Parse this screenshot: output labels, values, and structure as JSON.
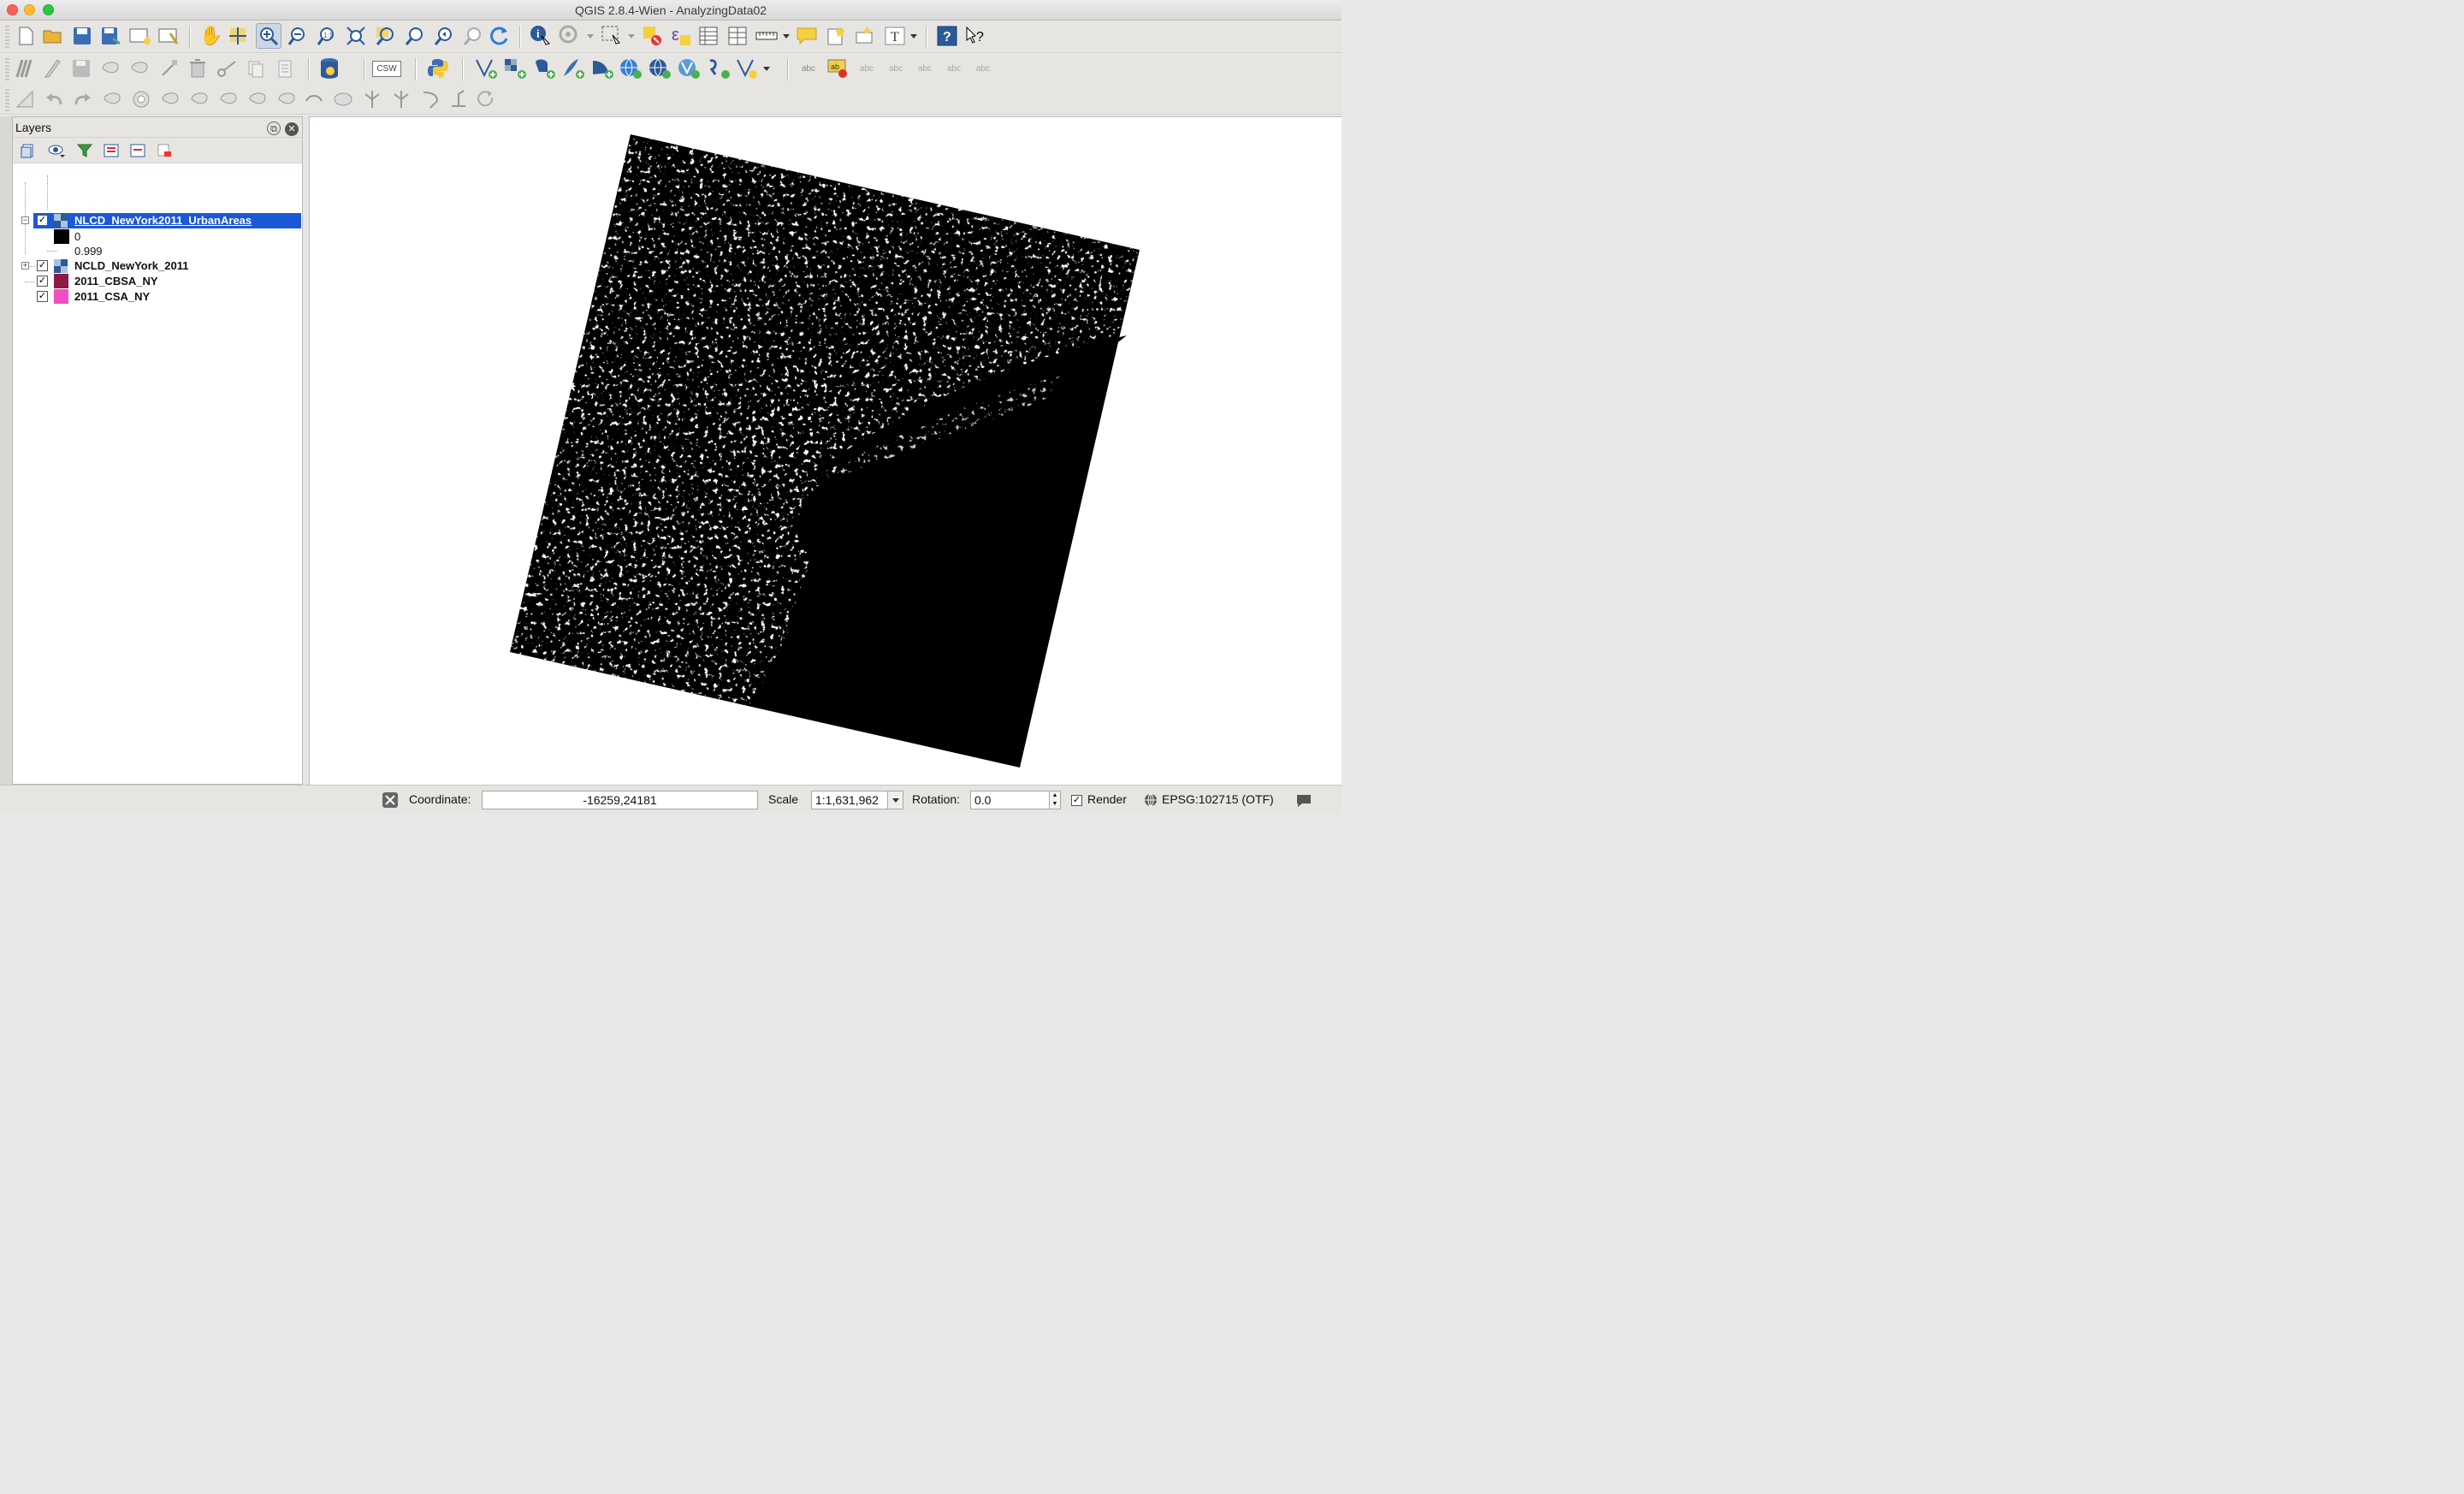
{
  "window": {
    "title": "QGIS 2.8.4-Wien - AnalyzingData02"
  },
  "toolbar1": {
    "icons": [
      "new-project-icon",
      "open-project-icon",
      "save-project-icon",
      "save-as-icon",
      "new-print-composer-icon",
      "composer-manager-icon",
      "pan-icon",
      "pan-to-selection-icon",
      "zoom-in-icon",
      "zoom-out-icon",
      "zoom-actual-size-icon",
      "zoom-full-icon",
      "zoom-to-selection-icon",
      "zoom-to-layer-icon",
      "zoom-last-icon",
      "zoom-next-icon",
      "refresh-icon",
      "identify-icon",
      "run-action-icon",
      "select-features-icon",
      "deselect-icon",
      "select-by-expression-icon",
      "attribute-table-icon",
      "field-calculator-icon",
      "measure-icon",
      "map-tips-icon",
      "new-bookmark-icon",
      "show-bookmarks-icon",
      "text-annotation-icon",
      "help-icon",
      "whats-this-icon"
    ]
  },
  "toolbar2": {
    "csw_label": "CSW",
    "label_tools_text": "abc"
  },
  "layers_panel": {
    "title": "Layers",
    "layers": [
      {
        "name": "NLCD_NewYork2011_UrbanAreas",
        "checked": true,
        "expanded": true,
        "selected": true,
        "legend": [
          {
            "label": "0",
            "color": "#000000"
          },
          {
            "label": "0.999",
            "color": "#ffffff"
          }
        ]
      },
      {
        "name": "NCLD_NewYork_2011",
        "checked": true,
        "expanded": false
      },
      {
        "name": "2011_CBSA_NY",
        "checked": true,
        "color": "#8b1a46"
      },
      {
        "name": "2011_CSA_NY",
        "checked": true,
        "color": "#f04fc4"
      }
    ]
  },
  "statusbar": {
    "coordinate_label": "Coordinate:",
    "coordinate_value": "-16259,24181",
    "scale_label": "Scale",
    "scale_value": "1:1,631,962",
    "rotation_label": "Rotation:",
    "rotation_value": "0.0",
    "render_label": "Render",
    "render_checked": true,
    "crs_label": "EPSG:102715 (OTF)"
  },
  "colors": {
    "selection": "#1b58d6",
    "raster_land": "#000000",
    "raster_urban": "#ffffff"
  }
}
